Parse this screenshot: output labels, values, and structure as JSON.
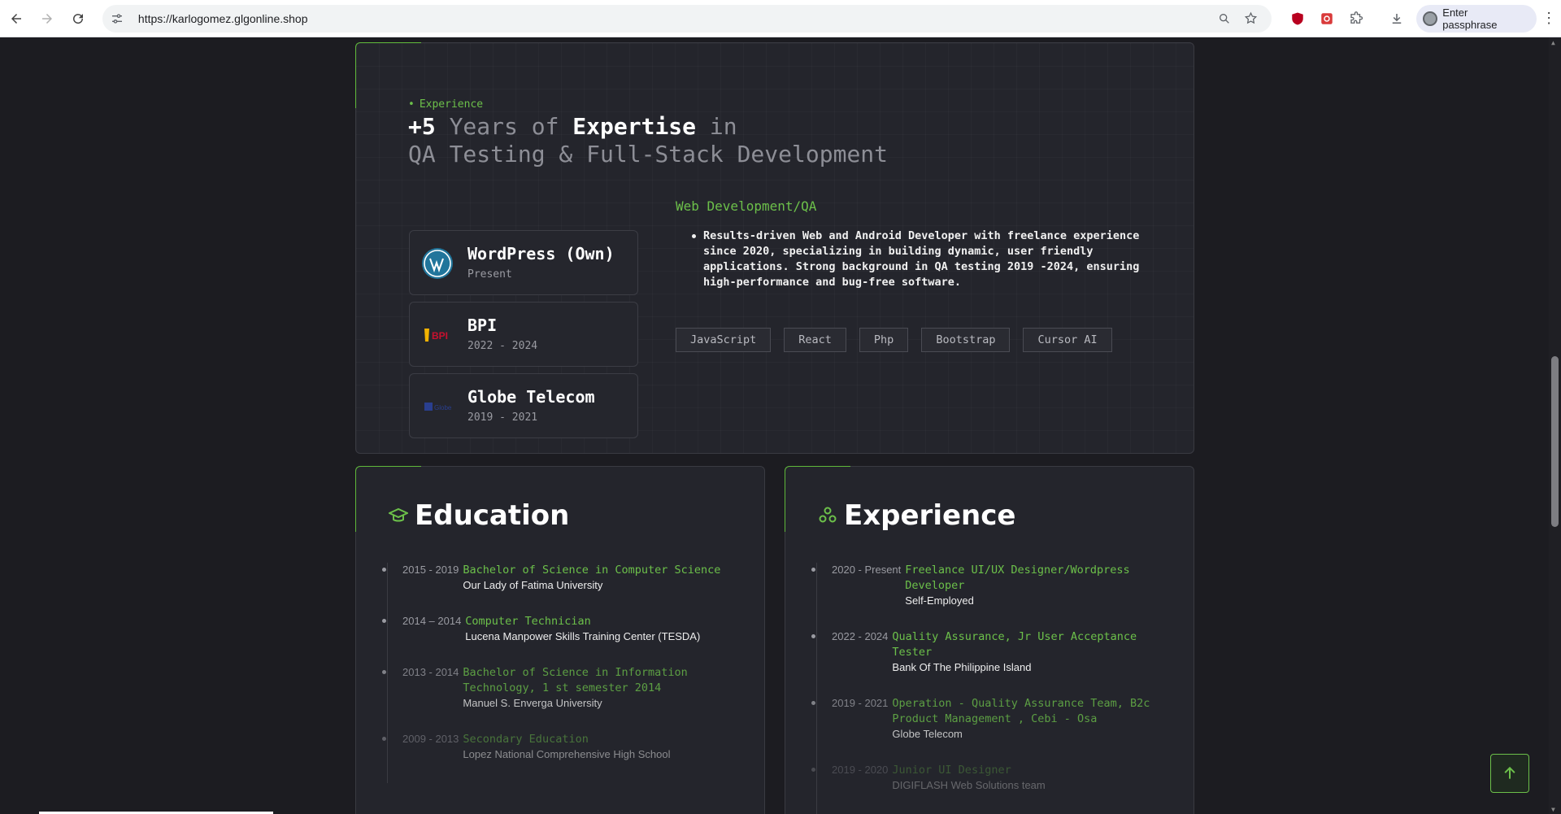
{
  "browser": {
    "url": "https://karlogomez.glgonline.shop",
    "profile_label": "Enter passphrase"
  },
  "hero": {
    "eyebrow": "Experience",
    "headline": {
      "prefix": "+5",
      "years_of": " Years of ",
      "expertise": "Expertise",
      "in": " in",
      "line2": "QA Testing & Full-Stack Development"
    }
  },
  "jobs": [
    {
      "name": "WordPress (Own)",
      "date": "Present",
      "logo": "wordpress-logo"
    },
    {
      "name": "BPI",
      "date": "2022 - 2024",
      "logo": "bpi-logo"
    },
    {
      "name": "Globe Telecom",
      "date": "2019 - 2021",
      "logo": "globe-logo"
    }
  ],
  "logos": {
    "bpi_text": "BPI",
    "globe_text": "Globe"
  },
  "role": {
    "title": "Web Development/QA",
    "description": "Results-driven Web and Android Developer with freelance experience since 2020, specializing in building dynamic, user friendly applications. Strong background in QA testing 2019 -2024, ensuring high-performance and bug-free software.",
    "tags": [
      "JavaScript",
      "React",
      "Php",
      "Bootstrap",
      "Cursor AI"
    ]
  },
  "education": {
    "title": "Education",
    "items": [
      {
        "date": "2015 - 2019",
        "title": "Bachelor of Science in Computer Science",
        "org": "Our Lady of Fatima University"
      },
      {
        "date": "2014 – 2014",
        "title": "Computer Technician",
        "org": "Lucena Manpower Skills Training Center (TESDA)"
      },
      {
        "date": "2013 - 2014",
        "title": "Bachelor of Science in Information Technology, 1 st semester 2014",
        "org": "Manuel S. Enverga University"
      },
      {
        "date": "2009 - 2013",
        "title": "Secondary Education",
        "org": "Lopez National Comprehensive High School"
      }
    ]
  },
  "experience": {
    "title": "Experience",
    "items": [
      {
        "date": "2020 - Present",
        "title": "Freelance UI/UX Designer/Wordpress Developer",
        "org": "Self-Employed"
      },
      {
        "date": "2022 - 2024",
        "title": "Quality Assurance, Jr User Acceptance Tester",
        "org": "Bank Of The Philippine Island"
      },
      {
        "date": "2019 - 2021",
        "title": "Operation - Quality Assurance Team, B2c Product Management , Cebi - Osa",
        "org": "Globe Telecom"
      },
      {
        "date": "2019 - 2020",
        "title": "Junior UI Designer",
        "org": "DIGIFLASH Web Solutions team"
      }
    ]
  },
  "colors": {
    "accent": "#6cc04a",
    "card": "#24252c",
    "background": "#1c1c21"
  }
}
